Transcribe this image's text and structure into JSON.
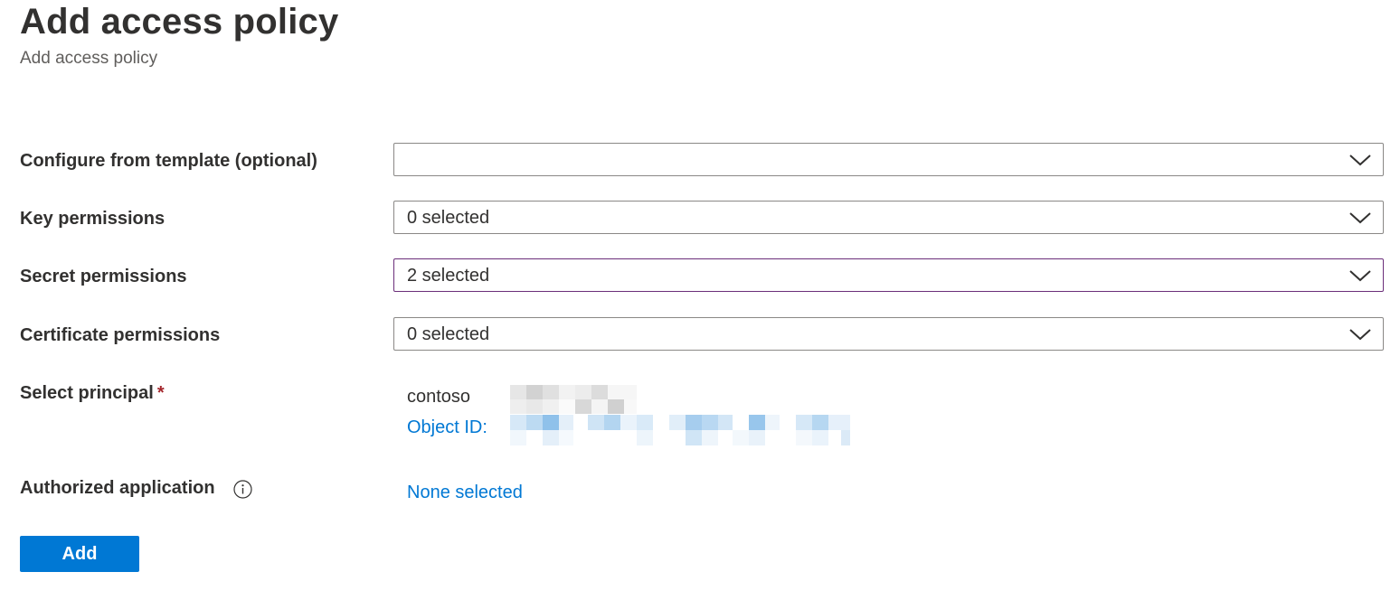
{
  "header": {
    "title": "Add access policy",
    "subtitle": "Add access policy"
  },
  "form": {
    "template": {
      "label": "Configure from template (optional)",
      "value": ""
    },
    "key_permissions": {
      "label": "Key permissions",
      "value": "0 selected"
    },
    "secret_permissions": {
      "label": "Secret permissions",
      "value": "2 selected"
    },
    "certificate_permissions": {
      "label": "Certificate permissions",
      "value": "0 selected"
    },
    "principal": {
      "label": "Select principal",
      "required_marker": "*",
      "name": "contoso",
      "object_id_label": "Object ID:"
    },
    "authorized_application": {
      "label": "Authorized application",
      "value": "None selected"
    }
  },
  "actions": {
    "add_label": "Add"
  },
  "colors": {
    "accent": "#0078d4",
    "focused_border": "#6b2e7a",
    "required": "#a4262c"
  }
}
